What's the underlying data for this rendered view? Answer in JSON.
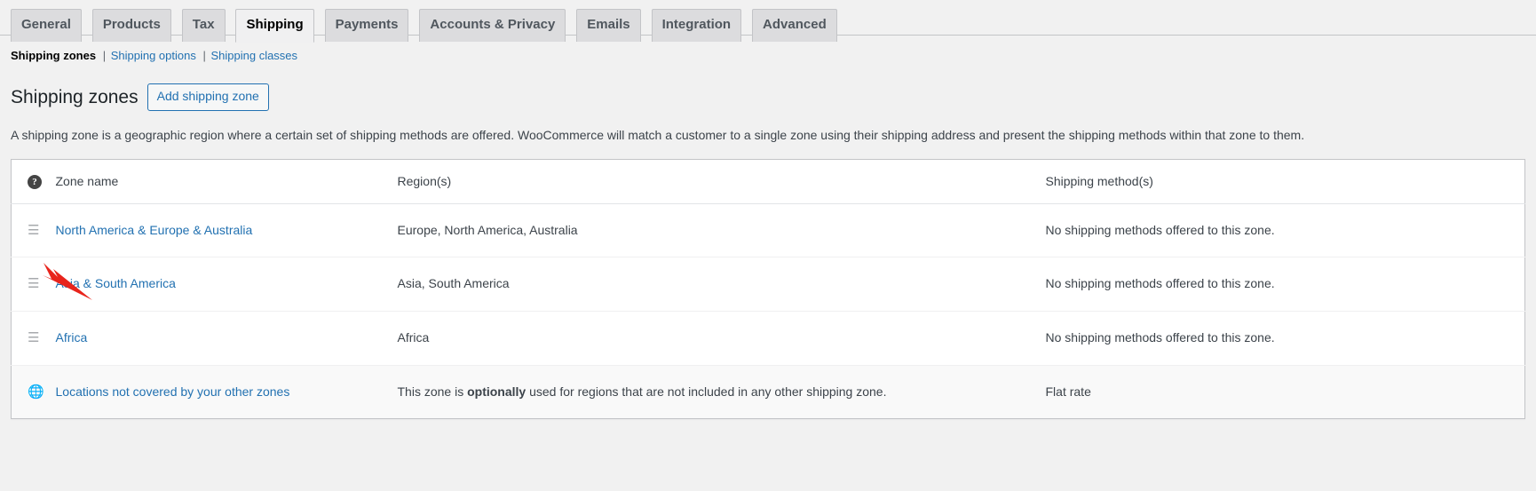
{
  "tabs": [
    {
      "label": "General",
      "active": false
    },
    {
      "label": "Products",
      "active": false
    },
    {
      "label": "Tax",
      "active": false
    },
    {
      "label": "Shipping",
      "active": true
    },
    {
      "label": "Payments",
      "active": false
    },
    {
      "label": "Accounts & Privacy",
      "active": false
    },
    {
      "label": "Emails",
      "active": false
    },
    {
      "label": "Integration",
      "active": false
    },
    {
      "label": "Advanced",
      "active": false
    }
  ],
  "subnav": {
    "items": [
      {
        "label": "Shipping zones",
        "current": true
      },
      {
        "label": "Shipping options",
        "current": false
      },
      {
        "label": "Shipping classes",
        "current": false
      }
    ],
    "separator": "|"
  },
  "page": {
    "title": "Shipping zones",
    "add_button_label": "Add shipping zone",
    "description": "A shipping zone is a geographic region where a certain set of shipping methods are offered. WooCommerce will match a customer to a single zone using their shipping address and present the shipping methods within that zone to them."
  },
  "table": {
    "headers": {
      "help_icon": "?",
      "zone_name": "Zone name",
      "regions": "Region(s)",
      "shipping_methods": "Shipping method(s)"
    },
    "rows": [
      {
        "sort_handle_icon": "sort-handle-icon",
        "zone_name": "North America & Europe & Australia",
        "regions": "Europe, North America, Australia",
        "shipping_methods": "No shipping methods offered to this zone."
      },
      {
        "sort_handle_icon": "sort-handle-icon",
        "zone_name": "Asia & South America",
        "regions": "Asia, South America",
        "shipping_methods": "No shipping methods offered to this zone."
      },
      {
        "sort_handle_icon": "sort-handle-icon",
        "zone_name": "Africa",
        "regions": "Africa",
        "shipping_methods": "No shipping methods offered to this zone."
      }
    ],
    "worldwide_row": {
      "globe_icon": "globe-icon",
      "zone_name": "Locations not covered by your other zones",
      "region_prefix": "This zone is ",
      "region_emphasis": "optionally",
      "region_suffix": " used for regions that are not included in any other shipping zone.",
      "shipping_methods": "Flat rate"
    }
  },
  "annotation": {
    "arrow_color": "#e8241c",
    "points_at": "Asia & South America sort handle"
  }
}
